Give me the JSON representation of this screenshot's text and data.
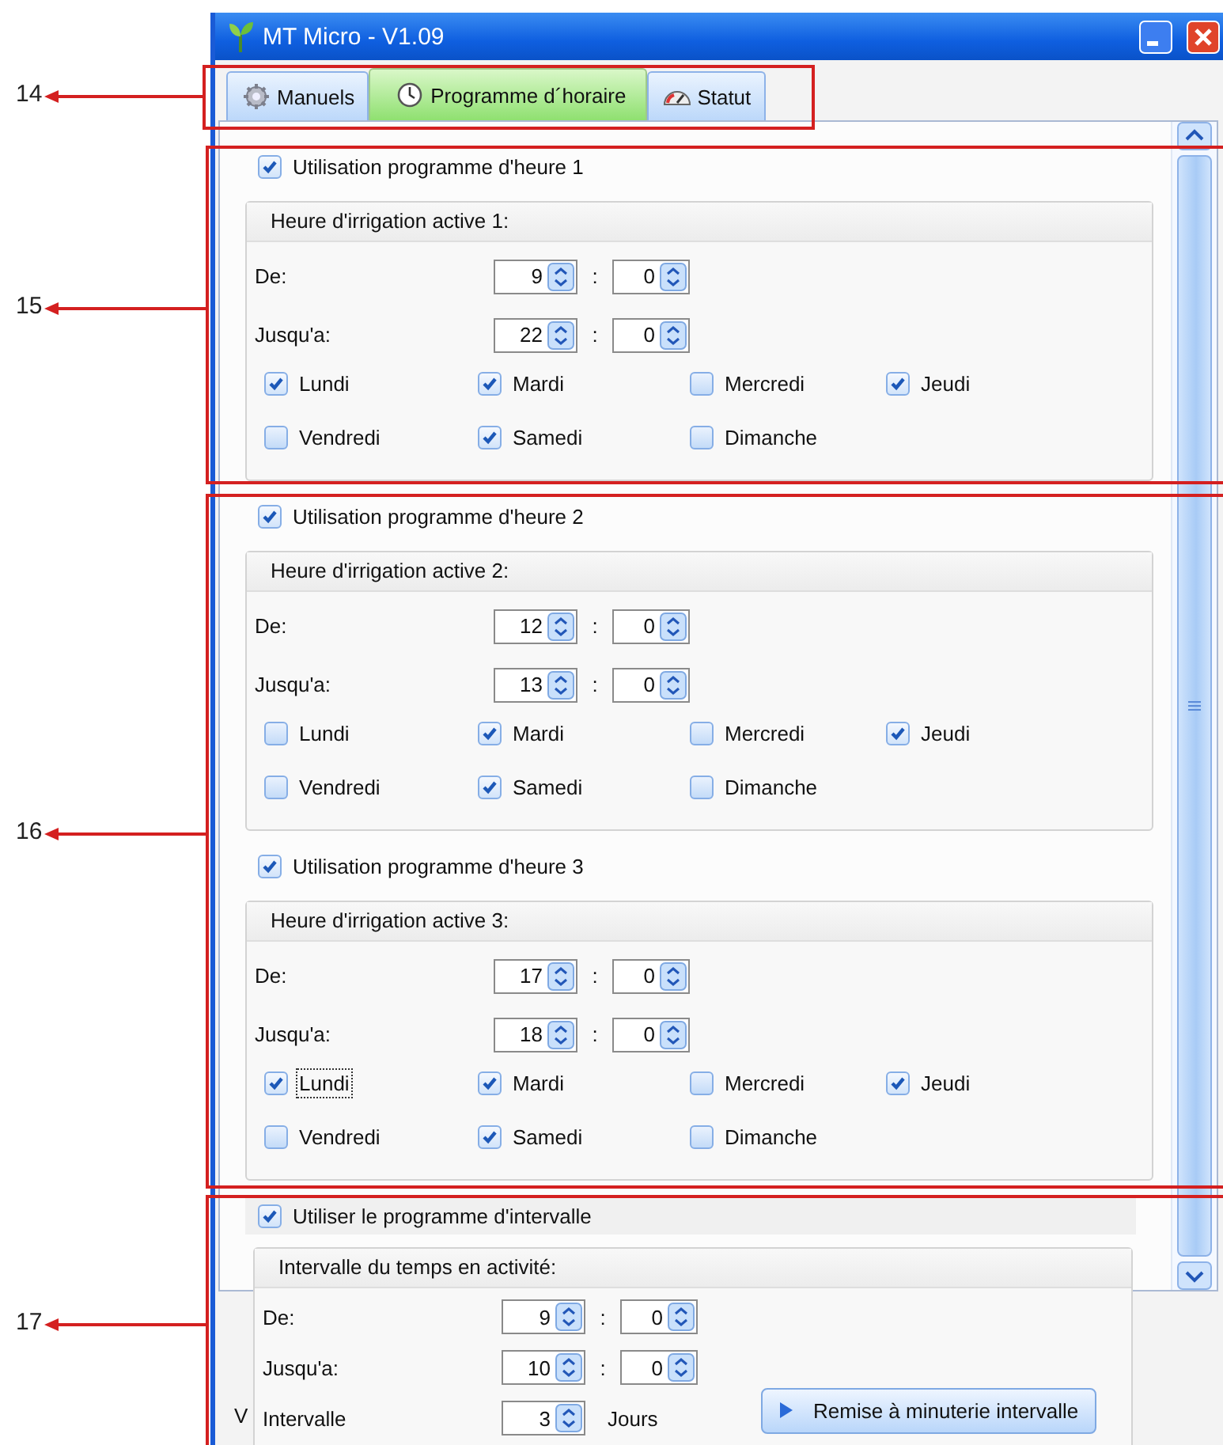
{
  "annotations": [
    {
      "label": "14"
    },
    {
      "label": "15"
    },
    {
      "label": "16"
    },
    {
      "label": "17"
    }
  ],
  "window": {
    "title": "MT Micro - V1.09"
  },
  "tabs": [
    {
      "label": "Manuels",
      "selected": false
    },
    {
      "label": "Programme d´horaire",
      "selected": true
    },
    {
      "label": "Statut",
      "selected": false
    }
  ],
  "programs": [
    {
      "enable_label": "Utilisation programme d'heure 1",
      "enabled": true,
      "group_title": "Heure d'irrigation active 1:",
      "rows": [
        {
          "label": "De:",
          "hour": "9",
          "separator": ":",
          "minute": "0"
        },
        {
          "label": "Jusqu'a:",
          "hour": "22",
          "separator": ":",
          "minute": "0"
        }
      ],
      "days": [
        {
          "label": "Lundi",
          "checked": true,
          "focused": false
        },
        {
          "label": "Mardi",
          "checked": true,
          "focused": false
        },
        {
          "label": "Mercredi",
          "checked": false,
          "focused": false
        },
        {
          "label": "Jeudi",
          "checked": true,
          "focused": false
        },
        {
          "label": "Vendredi",
          "checked": false,
          "focused": false
        },
        {
          "label": "Samedi",
          "checked": true,
          "focused": false
        },
        {
          "label": "Dimanche",
          "checked": false,
          "focused": false
        }
      ]
    },
    {
      "enable_label": "Utilisation programme d'heure 2",
      "enabled": true,
      "group_title": "Heure d'irrigation active 2:",
      "rows": [
        {
          "label": "De:",
          "hour": "12",
          "separator": ":",
          "minute": "0"
        },
        {
          "label": "Jusqu'a:",
          "hour": "13",
          "separator": ":",
          "minute": "0"
        }
      ],
      "days": [
        {
          "label": "Lundi",
          "checked": false,
          "focused": false
        },
        {
          "label": "Mardi",
          "checked": true,
          "focused": false
        },
        {
          "label": "Mercredi",
          "checked": false,
          "focused": false
        },
        {
          "label": "Jeudi",
          "checked": true,
          "focused": false
        },
        {
          "label": "Vendredi",
          "checked": false,
          "focused": false
        },
        {
          "label": "Samedi",
          "checked": true,
          "focused": false
        },
        {
          "label": "Dimanche",
          "checked": false,
          "focused": false
        }
      ]
    },
    {
      "enable_label": "Utilisation programme d'heure 3",
      "enabled": true,
      "group_title": "Heure d'irrigation active 3:",
      "rows": [
        {
          "label": "De:",
          "hour": "17",
          "separator": ":",
          "minute": "0"
        },
        {
          "label": "Jusqu'a:",
          "hour": "18",
          "separator": ":",
          "minute": "0"
        }
      ],
      "days": [
        {
          "label": "Lundi",
          "checked": true,
          "focused": true
        },
        {
          "label": "Mardi",
          "checked": true,
          "focused": false
        },
        {
          "label": "Mercredi",
          "checked": false,
          "focused": false
        },
        {
          "label": "Jeudi",
          "checked": true,
          "focused": false
        },
        {
          "label": "Vendredi",
          "checked": false,
          "focused": false
        },
        {
          "label": "Samedi",
          "checked": true,
          "focused": false
        },
        {
          "label": "Dimanche",
          "checked": false,
          "focused": false
        }
      ]
    }
  ],
  "interval": {
    "enable_label": "Utiliser le programme d'intervalle",
    "enabled": true,
    "group_title": "Intervalle du temps en activité:",
    "rows": [
      {
        "label": "De:",
        "hour": "9",
        "separator": ":",
        "minute": "0"
      },
      {
        "label": "Jusqu'a:",
        "hour": "10",
        "separator": ":",
        "minute": "0"
      }
    ],
    "interval_row": {
      "label": "Intervalle",
      "value": "3",
      "unit": "Jours"
    },
    "reset_button": "Remise à  minuterie intervalle"
  },
  "hidden_fragment": "V"
}
